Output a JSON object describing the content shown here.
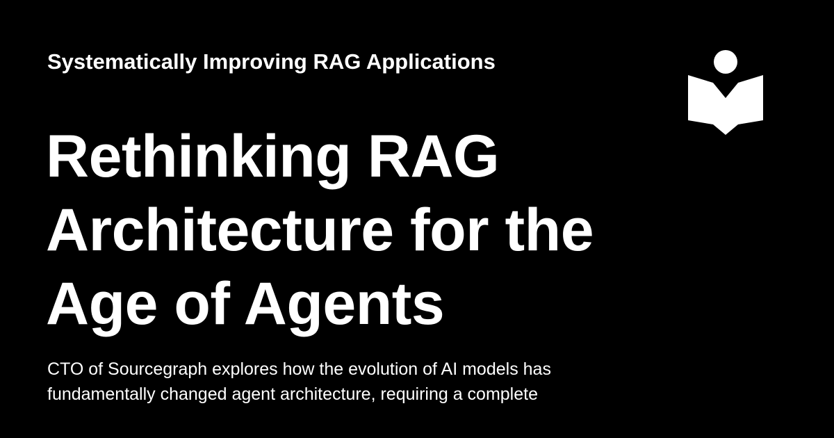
{
  "card": {
    "series_title": "Systematically Improving RAG Applications",
    "title_lines": [
      "Rethinking RAG",
      "Architecture for the",
      "Age of Agents"
    ],
    "description_lines": [
      "CTO of Sourcegraph explores how the evolution of AI models has",
      "fundamentally changed agent architecture, requiring a complete"
    ],
    "logo_icon": "reader-book-icon"
  },
  "colors": {
    "background": "#000000",
    "text": "#ffffff"
  }
}
